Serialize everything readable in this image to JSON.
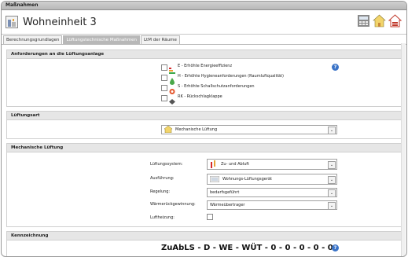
{
  "window": {
    "title": "Maßnahmen"
  },
  "header": {
    "unit_title": "Wohneinheit 3"
  },
  "tabs": [
    {
      "label": "Berechnungsgrundlagen"
    },
    {
      "label": "Lüftungstechnische Maßnahmen"
    },
    {
      "label": "LtM der Räume"
    }
  ],
  "requirements": {
    "heading": "Anforderungen an die Lüftungsanlage",
    "options": [
      {
        "label": "E - Erhöhte Energieeffizienz",
        "checked": false
      },
      {
        "label": "H - Erhöhte Hygieneanforderungen (Raumluftqualität)",
        "checked": false
      },
      {
        "label": "S - Erhöhte Schallschutzanforderungen",
        "checked": false
      },
      {
        "label": "RK - Rückschlagklappe",
        "checked": false
      }
    ],
    "help_icon": "?"
  },
  "ventilation_type": {
    "heading": "Lüftungsart",
    "selected": "Mechanische Lüftung"
  },
  "mechanical": {
    "heading": "Mechanische Lüftung",
    "system_label": "Lüftungssystem:",
    "system_value": "Zu- und Abluft",
    "design_label": "Ausführung:",
    "design_value": "Wohnungs-Lüftungsgerät",
    "control_label": "Regelung:",
    "control_value": "bedarfsgeführt",
    "heat_recovery_label": "Wärmerückgewinnung:",
    "heat_recovery_value": "Wärmeübertrager",
    "air_heating_label": "Luftheizung:",
    "air_heating_checked": false
  },
  "designation": {
    "heading": "Kennzeichnung",
    "code": "ZuAbLS - D - WE - WÜT - 0 - 0 - 0 - 0 - 0",
    "help_icon": "?"
  },
  "colors": {
    "help_blue": "#3a73c7",
    "section_gray": "#e6e6e6",
    "active_tab": "#b8b8b8"
  }
}
